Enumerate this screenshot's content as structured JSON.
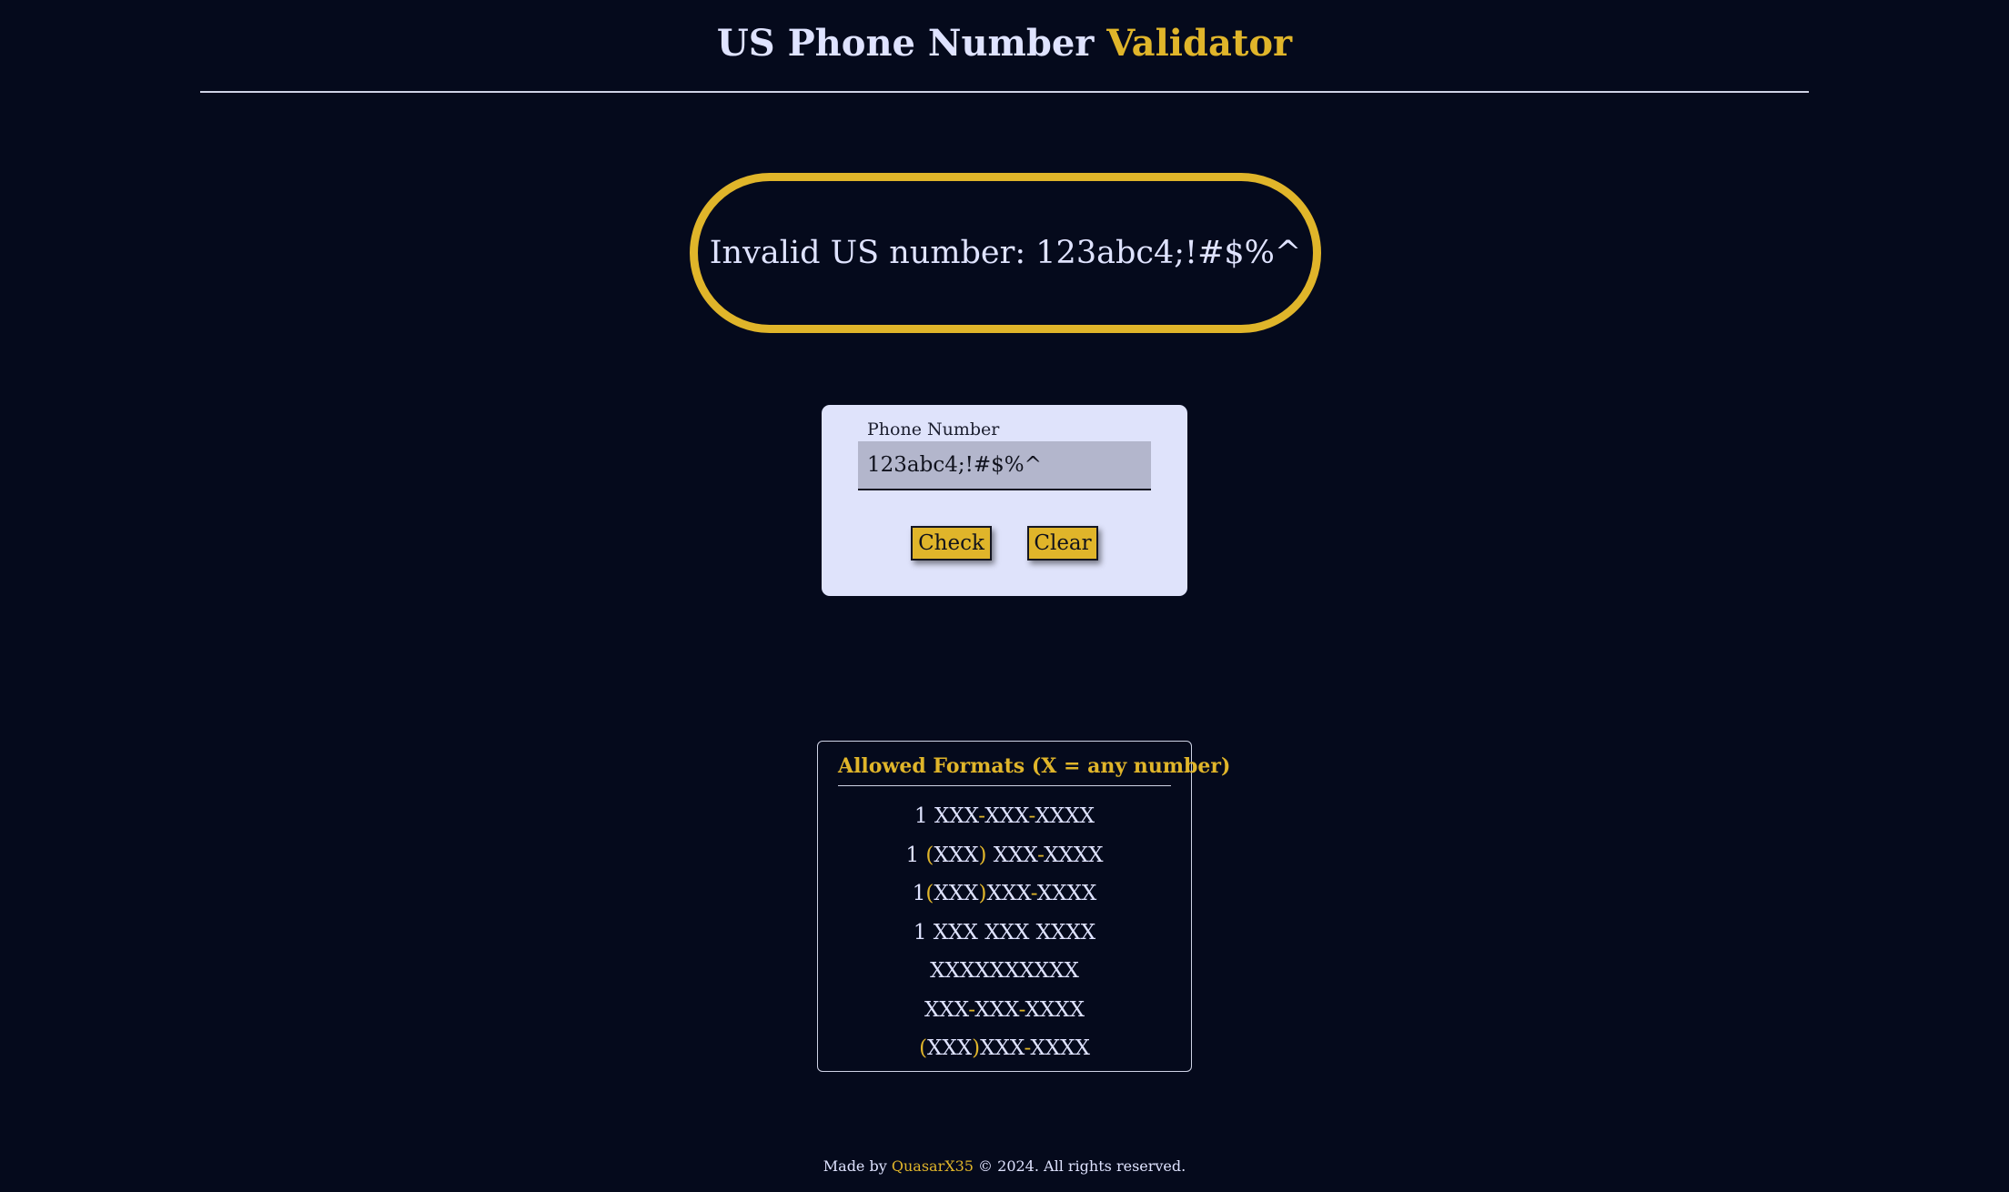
{
  "header": {
    "title_main": "US Phone Number",
    "title_accent": "Validator"
  },
  "result": {
    "text": "Invalid US number: 123abc4;!#$%^"
  },
  "form": {
    "label": "Phone Number",
    "input_value": "123abc4;!#$%^",
    "check_label": "Check",
    "clear_label": "Clear"
  },
  "formats": {
    "title": "Allowed Formats (X = any number)",
    "items": [
      [
        {
          "t": "1 XXX",
          "s": false
        },
        {
          "t": "-",
          "s": true
        },
        {
          "t": "XXX",
          "s": false
        },
        {
          "t": "-",
          "s": true
        },
        {
          "t": "XXXX",
          "s": false
        }
      ],
      [
        {
          "t": "1 ",
          "s": false
        },
        {
          "t": "(",
          "s": true
        },
        {
          "t": "XXX",
          "s": false
        },
        {
          "t": ")",
          "s": true
        },
        {
          "t": " XXX",
          "s": false
        },
        {
          "t": "-",
          "s": true
        },
        {
          "t": "XXXX",
          "s": false
        }
      ],
      [
        {
          "t": "1",
          "s": false
        },
        {
          "t": "(",
          "s": true
        },
        {
          "t": "XXX",
          "s": false
        },
        {
          "t": ")",
          "s": true
        },
        {
          "t": "XXX",
          "s": false
        },
        {
          "t": "-",
          "s": true
        },
        {
          "t": "XXXX",
          "s": false
        }
      ],
      [
        {
          "t": "1 XXX XXX XXXX",
          "s": false
        }
      ],
      [
        {
          "t": "XXXXXXXXXX",
          "s": false
        }
      ],
      [
        {
          "t": "XXX",
          "s": false
        },
        {
          "t": "-",
          "s": true
        },
        {
          "t": "XXX",
          "s": false
        },
        {
          "t": "-",
          "s": true
        },
        {
          "t": "XXXX",
          "s": false
        }
      ],
      [
        {
          "t": "(",
          "s": true
        },
        {
          "t": "XXX",
          "s": false
        },
        {
          "t": ")",
          "s": true
        },
        {
          "t": "XXX",
          "s": false
        },
        {
          "t": "-",
          "s": true
        },
        {
          "t": "XXXX",
          "s": false
        }
      ]
    ]
  },
  "footer": {
    "prefix": "Made by ",
    "author": "QuasarX35",
    "suffix": " © 2024. All rights reserved."
  },
  "colors": {
    "background": "#050a1c",
    "accent": "#e0b52a",
    "text": "#dfe3ff",
    "card": "#dfe3fb"
  }
}
